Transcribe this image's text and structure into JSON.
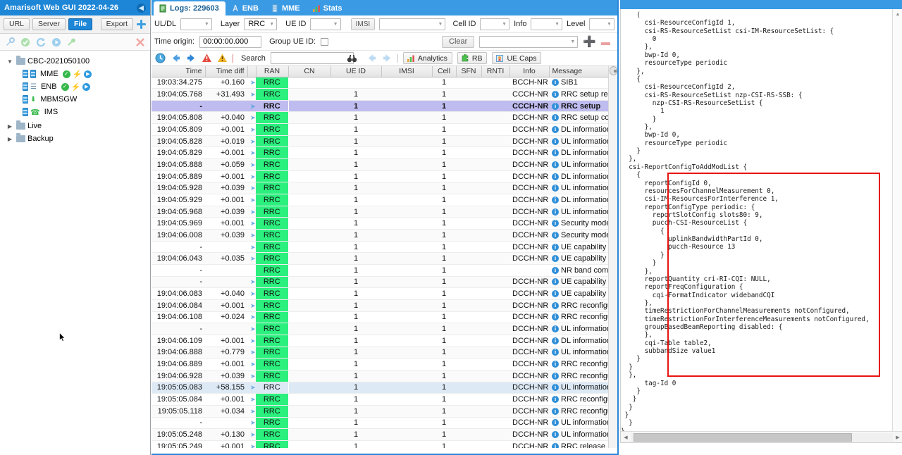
{
  "left_panel": {
    "title": "Amarisoft Web GUI 2022-04-26",
    "collapse_icon": "chevron-left-icon",
    "tabs": [
      {
        "label": "URL",
        "active": false
      },
      {
        "label": "Server",
        "active": false
      },
      {
        "label": "File",
        "active": true
      }
    ],
    "export_label": "Export",
    "add_icon": "plus-icon",
    "toolbar_icons": [
      "wrench-icon",
      "check-circle-icon",
      "refresh-icon",
      "play-circle-icon",
      "plug-icon",
      "delete-x-icon"
    ],
    "tree": [
      {
        "label": "CBC-2021050100",
        "type": "folder",
        "expanded": true,
        "depth": 0,
        "badges": []
      },
      {
        "label": "MME",
        "type": "service",
        "depth": 1,
        "badges": [
          "ok",
          "bolt",
          "play"
        ]
      },
      {
        "label": "ENB",
        "type": "service",
        "depth": 1,
        "badges": [
          "ok",
          "bolt",
          "play"
        ]
      },
      {
        "label": "MBMSGW",
        "type": "service",
        "depth": 1,
        "badges": []
      },
      {
        "label": "IMS",
        "type": "service",
        "depth": 1,
        "badges": []
      },
      {
        "label": "Live",
        "type": "folder",
        "expanded": false,
        "depth": 0,
        "badges": []
      },
      {
        "label": "Backup",
        "type": "folder",
        "expanded": false,
        "depth": 0,
        "badges": []
      }
    ]
  },
  "tabs": [
    {
      "label": "Logs: 229603",
      "icon": "document-icon",
      "active": true
    },
    {
      "label": "ENB",
      "icon": "antenna-icon",
      "active": false
    },
    {
      "label": "MME",
      "icon": "server-icon",
      "active": false
    },
    {
      "label": "Stats",
      "icon": "chart-icon",
      "active": false
    }
  ],
  "filters": {
    "uldl_label": "UL/DL",
    "uldl_value": "",
    "layer_label": "Layer",
    "layer_value": "RRC",
    "ueid_label": "UE ID",
    "ueid_value": "",
    "imsi_label": "IMSI",
    "imsi_value": "",
    "cellid_label": "Cell ID",
    "cellid_value": "",
    "info_label": "Info",
    "info_value": "",
    "level_label": "Level",
    "level_value": "",
    "time_origin_label": "Time origin:",
    "time_origin_value": "00:00:00.000",
    "group_ueid_label": "Group UE ID:",
    "group_ueid_checked": false,
    "clear_label": "Clear",
    "clear_select_value": "",
    "add_icon": "plus-icon",
    "remove_icon": "minus-icon"
  },
  "toolbar": {
    "icons": [
      "clock-icon",
      "arrow-left-icon",
      "arrow-right-icon",
      "error-triangle-icon",
      "warning-triangle-icon"
    ],
    "search_label": "Search",
    "search_value": "",
    "search_placeholder": "",
    "binoculars_icon": "binoculars-icon",
    "prev_icon": "arrow-left-icon",
    "next_icon": "arrow-right-icon",
    "analytics_label": "Analytics",
    "analytics_icon": "chart-icon",
    "rb_label": "RB",
    "rb_icon": "puzzle-icon",
    "uecaps_label": "UE Caps",
    "uecaps_icon": "certificate-icon"
  },
  "table": {
    "columns": [
      "Time",
      "Time diff",
      "",
      "RAN",
      "CN",
      "UE ID",
      "IMSI",
      "Cell",
      "SFN",
      "RNTI",
      "Info",
      "Message"
    ],
    "rows": [
      {
        "time": "19:03:34.275",
        "diff": "+0.160",
        "arrow": true,
        "ran": "RRC",
        "cn": "",
        "ueid": "",
        "imsi": "",
        "cell": "1",
        "sfn": "",
        "rnti": "",
        "info": "BCCH-NR",
        "msg": "SIB1",
        "state": "normal"
      },
      {
        "time": "19:04:05.768",
        "diff": "+31.493",
        "arrow": true,
        "ran": "RRC",
        "cn": "",
        "ueid": "1",
        "imsi": "",
        "cell": "1",
        "sfn": "",
        "rnti": "",
        "info": "CCCH-NR",
        "msg": "RRC setup request",
        "state": "alt"
      },
      {
        "time": "-",
        "diff": "",
        "arrow": true,
        "ran": "RRC",
        "cn": "",
        "ueid": "1",
        "imsi": "",
        "cell": "1",
        "sfn": "",
        "rnti": "",
        "info": "CCCH-NR",
        "msg": "RRC setup",
        "state": "selected"
      },
      {
        "time": "19:04:05.808",
        "diff": "+0.040",
        "arrow": true,
        "ran": "RRC",
        "cn": "",
        "ueid": "1",
        "imsi": "",
        "cell": "1",
        "sfn": "",
        "rnti": "",
        "info": "DCCH-NR",
        "msg": "RRC setup complete",
        "state": "alt"
      },
      {
        "time": "19:04:05.809",
        "diff": "+0.001",
        "arrow": true,
        "ran": "RRC",
        "cn": "",
        "ueid": "1",
        "imsi": "",
        "cell": "1",
        "sfn": "",
        "rnti": "",
        "info": "DCCH-NR",
        "msg": "DL information transfer",
        "state": "normal"
      },
      {
        "time": "19:04:05.828",
        "diff": "+0.019",
        "arrow": true,
        "ran": "RRC",
        "cn": "",
        "ueid": "1",
        "imsi": "",
        "cell": "1",
        "sfn": "",
        "rnti": "",
        "info": "DCCH-NR",
        "msg": "UL information transfer",
        "state": "alt"
      },
      {
        "time": "19:04:05.829",
        "diff": "+0.001",
        "arrow": true,
        "ran": "RRC",
        "cn": "",
        "ueid": "1",
        "imsi": "",
        "cell": "1",
        "sfn": "",
        "rnti": "",
        "info": "DCCH-NR",
        "msg": "DL information transfer",
        "state": "normal"
      },
      {
        "time": "19:04:05.888",
        "diff": "+0.059",
        "arrow": true,
        "ran": "RRC",
        "cn": "",
        "ueid": "1",
        "imsi": "",
        "cell": "1",
        "sfn": "",
        "rnti": "",
        "info": "DCCH-NR",
        "msg": "UL information transfer",
        "state": "alt"
      },
      {
        "time": "19:04:05.889",
        "diff": "+0.001",
        "arrow": true,
        "ran": "RRC",
        "cn": "",
        "ueid": "1",
        "imsi": "",
        "cell": "1",
        "sfn": "",
        "rnti": "",
        "info": "DCCH-NR",
        "msg": "DL information transfer",
        "state": "normal"
      },
      {
        "time": "19:04:05.928",
        "diff": "+0.039",
        "arrow": true,
        "ran": "RRC",
        "cn": "",
        "ueid": "1",
        "imsi": "",
        "cell": "1",
        "sfn": "",
        "rnti": "",
        "info": "DCCH-NR",
        "msg": "UL information transfer",
        "state": "alt"
      },
      {
        "time": "19:04:05.929",
        "diff": "+0.001",
        "arrow": true,
        "ran": "RRC",
        "cn": "",
        "ueid": "1",
        "imsi": "",
        "cell": "1",
        "sfn": "",
        "rnti": "",
        "info": "DCCH-NR",
        "msg": "DL information transfer",
        "state": "normal"
      },
      {
        "time": "19:04:05.968",
        "diff": "+0.039",
        "arrow": true,
        "ran": "RRC",
        "cn": "",
        "ueid": "1",
        "imsi": "",
        "cell": "1",
        "sfn": "",
        "rnti": "",
        "info": "DCCH-NR",
        "msg": "UL information transfer",
        "state": "alt"
      },
      {
        "time": "19:04:05.969",
        "diff": "+0.001",
        "arrow": true,
        "ran": "RRC",
        "cn": "",
        "ueid": "1",
        "imsi": "",
        "cell": "1",
        "sfn": "",
        "rnti": "",
        "info": "DCCH-NR",
        "msg": "Security mode command",
        "state": "normal"
      },
      {
        "time": "19:04:06.008",
        "diff": "+0.039",
        "arrow": true,
        "ran": "RRC",
        "cn": "",
        "ueid": "1",
        "imsi": "",
        "cell": "1",
        "sfn": "",
        "rnti": "",
        "info": "DCCH-NR",
        "msg": "Security mode complete",
        "state": "alt"
      },
      {
        "time": "-",
        "diff": "",
        "arrow": true,
        "ran": "RRC",
        "cn": "",
        "ueid": "1",
        "imsi": "",
        "cell": "1",
        "sfn": "",
        "rnti": "",
        "info": "DCCH-NR",
        "msg": "UE capability enquiry",
        "state": "normal"
      },
      {
        "time": "19:04:06.043",
        "diff": "+0.035",
        "arrow": true,
        "ran": "RRC",
        "cn": "",
        "ueid": "1",
        "imsi": "",
        "cell": "1",
        "sfn": "",
        "rnti": "",
        "info": "DCCH-NR",
        "msg": "UE capability information",
        "state": "alt"
      },
      {
        "time": "-",
        "diff": "",
        "arrow": false,
        "ran": "RRC",
        "cn": "",
        "ueid": "1",
        "imsi": "",
        "cell": "1",
        "sfn": "",
        "rnti": "",
        "info": "",
        "msg": "NR band combinations",
        "state": "normal"
      },
      {
        "time": "-",
        "diff": "",
        "arrow": true,
        "ran": "RRC",
        "cn": "",
        "ueid": "1",
        "imsi": "",
        "cell": "1",
        "sfn": "",
        "rnti": "",
        "info": "DCCH-NR",
        "msg": "UE capability enquiry",
        "state": "alt"
      },
      {
        "time": "19:04:06.083",
        "diff": "+0.040",
        "arrow": true,
        "ran": "RRC",
        "cn": "",
        "ueid": "1",
        "imsi": "",
        "cell": "1",
        "sfn": "",
        "rnti": "",
        "info": "DCCH-NR",
        "msg": "UE capability information",
        "state": "normal"
      },
      {
        "time": "19:04:06.084",
        "diff": "+0.001",
        "arrow": true,
        "ran": "RRC",
        "cn": "",
        "ueid": "1",
        "imsi": "",
        "cell": "1",
        "sfn": "",
        "rnti": "",
        "info": "DCCH-NR",
        "msg": "RRC reconfiguration",
        "state": "alt"
      },
      {
        "time": "19:04:06.108",
        "diff": "+0.024",
        "arrow": true,
        "ran": "RRC",
        "cn": "",
        "ueid": "1",
        "imsi": "",
        "cell": "1",
        "sfn": "",
        "rnti": "",
        "info": "DCCH-NR",
        "msg": "RRC reconfiguration complete",
        "state": "normal"
      },
      {
        "time": "-",
        "diff": "",
        "arrow": true,
        "ran": "RRC",
        "cn": "",
        "ueid": "1",
        "imsi": "",
        "cell": "1",
        "sfn": "",
        "rnti": "",
        "info": "DCCH-NR",
        "msg": "UL information transfer",
        "state": "alt"
      },
      {
        "time": "19:04:06.109",
        "diff": "+0.001",
        "arrow": true,
        "ran": "RRC",
        "cn": "",
        "ueid": "1",
        "imsi": "",
        "cell": "1",
        "sfn": "",
        "rnti": "",
        "info": "DCCH-NR",
        "msg": "DL information transfer",
        "state": "normal"
      },
      {
        "time": "19:04:06.888",
        "diff": "+0.779",
        "arrow": true,
        "ran": "RRC",
        "cn": "",
        "ueid": "1",
        "imsi": "",
        "cell": "1",
        "sfn": "",
        "rnti": "",
        "info": "DCCH-NR",
        "msg": "UL information transfer",
        "state": "alt"
      },
      {
        "time": "19:04:06.889",
        "diff": "+0.001",
        "arrow": true,
        "ran": "RRC",
        "cn": "",
        "ueid": "1",
        "imsi": "",
        "cell": "1",
        "sfn": "",
        "rnti": "",
        "info": "DCCH-NR",
        "msg": "RRC reconfiguration",
        "state": "normal"
      },
      {
        "time": "19:04:06.928",
        "diff": "+0.039",
        "arrow": true,
        "ran": "RRC",
        "cn": "",
        "ueid": "1",
        "imsi": "",
        "cell": "1",
        "sfn": "",
        "rnti": "",
        "info": "DCCH-NR",
        "msg": "RRC reconfiguration complete",
        "state": "alt"
      },
      {
        "time": "19:05:05.083",
        "diff": "+58.155",
        "arrow": true,
        "ran": "RRC",
        "cn": "",
        "ueid": "1",
        "imsi": "",
        "cell": "1",
        "sfn": "",
        "rnti": "",
        "info": "DCCH-NR",
        "msg": "UL information transfer",
        "state": "highlight"
      },
      {
        "time": "19:05:05.084",
        "diff": "+0.001",
        "arrow": true,
        "ran": "RRC",
        "cn": "",
        "ueid": "1",
        "imsi": "",
        "cell": "1",
        "sfn": "",
        "rnti": "",
        "info": "DCCH-NR",
        "msg": "RRC reconfiguration",
        "state": "normal"
      },
      {
        "time": "19:05:05.118",
        "diff": "+0.034",
        "arrow": true,
        "ran": "RRC",
        "cn": "",
        "ueid": "1",
        "imsi": "",
        "cell": "1",
        "sfn": "",
        "rnti": "",
        "info": "DCCH-NR",
        "msg": "RRC reconfiguration complete",
        "state": "alt"
      },
      {
        "time": "-",
        "diff": "",
        "arrow": true,
        "ran": "RRC",
        "cn": "",
        "ueid": "1",
        "imsi": "",
        "cell": "1",
        "sfn": "",
        "rnti": "",
        "info": "DCCH-NR",
        "msg": "UL information transfer",
        "state": "normal"
      },
      {
        "time": "19:05:05.248",
        "diff": "+0.130",
        "arrow": true,
        "ran": "RRC",
        "cn": "",
        "ueid": "1",
        "imsi": "",
        "cell": "1",
        "sfn": "",
        "rnti": "",
        "info": "DCCH-NR",
        "msg": "UL information transfer",
        "state": "alt"
      },
      {
        "time": "19:05:05.249",
        "diff": "+0.001",
        "arrow": true,
        "ran": "RRC",
        "cn": "",
        "ueid": "1",
        "imsi": "",
        "cell": "1",
        "sfn": "",
        "rnti": "",
        "info": "DCCH-NR",
        "msg": "RRC release",
        "state": "normal"
      }
    ]
  },
  "detail": {
    "text": "    (\n      csi-ResourceConfigId 1,\n      csi-RS-ResourceSetList csi-IM-ResourceSetList: {\n        0\n      },\n      bwp-Id 0,\n      resourceType periodic\n    },\n    {\n      csi-ResourceConfigId 2,\n      csi-RS-ResourceSetList nzp-CSI-RS-SSB: {\n        nzp-CSI-RS-ResourceSetList {\n          1\n        }\n      },\n      bwp-Id 0,\n      resourceType periodic\n    }\n  },\n  csi-ReportConfigToAddModList {\n    {\n      reportConfigId 0,\n      resourcesForChannelMeasurement 0,\n      csi-IM-ResourcesForInterference 1,\n      reportConfigType periodic: {\n        reportSlotConfig slots80: 9,\n        pucch-CSI-ResourceList {\n          {\n            uplinkBandwidthPartId 0,\n            pucch-Resource 13\n          }\n        }\n      },\n      reportQuantity cri-RI-CQI: NULL,\n      reportFreqConfiguration {\n        cqi-FormatIndicator widebandCQI\n      },\n      timeRestrictionForChannelMeasurements notConfigured,\n      timeRestrictionForInterferenceMeasurements notConfigured,\n      groupBasedBeamReporting disabled: {\n      },\n      cqi-Table table2,\n      subbandSize value1\n    }\n  }\n  },\n      tag-Id 0\n    }\n   }\n  }\n }\n  }\n}",
    "highlight_color": "#e8140f"
  }
}
